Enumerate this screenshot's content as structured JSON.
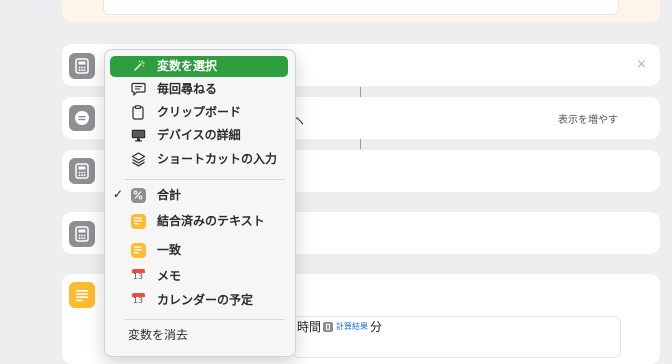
{
  "background_cards": {
    "show_more": "表示を増やす",
    "caret_char": "ヘ",
    "text_field": {
      "prefix": "時間",
      "variable": "計算結果",
      "suffix": "分"
    }
  },
  "menu": {
    "select_variable": "変数を選択",
    "ask_each_time": "毎回尋ねる",
    "clipboard": "クリップボード",
    "device_details": "デバイスの詳細",
    "shortcut_input": "ショートカットの入力",
    "sum": "合計",
    "combined_text": "結合済みのテキスト",
    "match": "一致",
    "memo": "メモ",
    "calendar_event": "カレンダーの予定",
    "clear_variable": "変数を消去",
    "calendar_day": "13",
    "check": "✓",
    "selected_item": "合計"
  },
  "colors": {
    "accent_green": "#2e9e3f",
    "variable_yellow": "#fdbb2e",
    "icon_grey": "#8e8e93"
  }
}
